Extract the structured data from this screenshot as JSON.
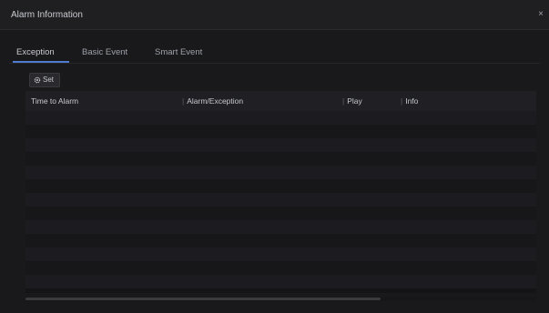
{
  "window": {
    "title": "Alarm Information",
    "close_glyph": "×"
  },
  "tabs": [
    {
      "label": "Exception",
      "active": true
    },
    {
      "label": "Basic Event",
      "active": false
    },
    {
      "label": "Smart Event",
      "active": false
    }
  ],
  "toolbar": {
    "set_label": "Set",
    "set_icon": "gear-icon"
  },
  "table": {
    "columns": [
      "Time to Alarm",
      "Alarm/Exception",
      "Play",
      "Info"
    ],
    "rows": []
  },
  "colors": {
    "accent": "#4e7bd0",
    "background": "#19191c"
  }
}
